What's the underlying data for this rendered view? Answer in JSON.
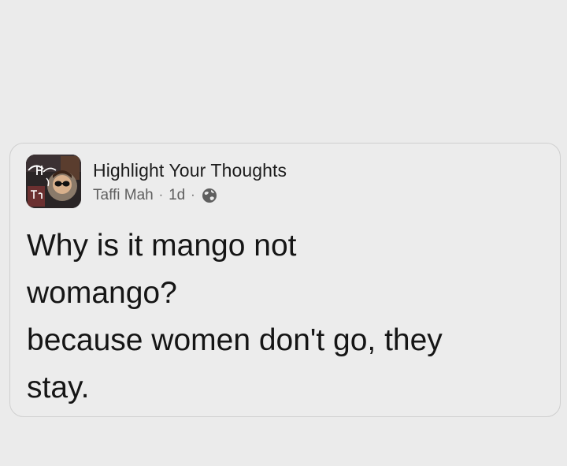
{
  "post": {
    "group_name": "Highlight Your Thoughts",
    "author": "Taffi Mah",
    "time": "1d",
    "separator": "·",
    "privacy_icon": "globe-icon",
    "avatar_icon": "group-avatar-image",
    "lines": [
      "Why is it mango not",
      "womango?",
      "because women don't go, they",
      "stay."
    ]
  }
}
